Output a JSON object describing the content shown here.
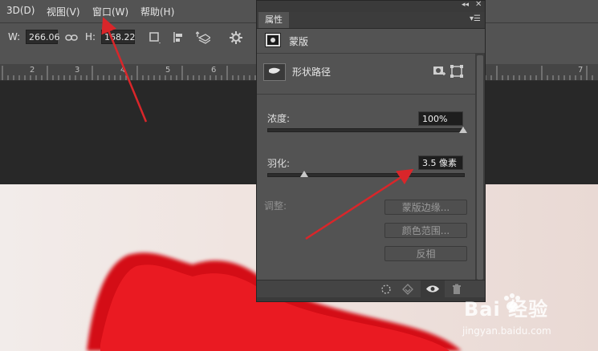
{
  "menu": {
    "items": [
      {
        "label": "3D(D)"
      },
      {
        "label": "视图(V)"
      },
      {
        "label": "窗口(W)"
      },
      {
        "label": "帮助(H)"
      }
    ]
  },
  "options": {
    "w_label": "W:",
    "w_value": "266.06",
    "h_label": "H:",
    "h_value": "168.22"
  },
  "ruler": {
    "numbers": [
      "2",
      "3",
      "4",
      "5",
      "6",
      "7"
    ]
  },
  "panel": {
    "tab_label": "属性",
    "mask_label": "蒙版",
    "shape_path_label": "形状路径",
    "density_label": "浓度:",
    "density_value": "100%",
    "density_fraction": 1.0,
    "feather_label": "羽化:",
    "feather_value": "3.5 像素",
    "feather_fraction": 0.19,
    "adjust_label": "调整:",
    "buttons": {
      "mask_edge": "蒙版边缘...",
      "color_range": "颜色范围...",
      "invert": "反相"
    }
  },
  "watermark": {
    "text": "Bai 经验",
    "url": "jingyan.baidu.com"
  },
  "colors": {
    "arrow": "#d9262a",
    "lip": "#e3121b",
    "skin": "#efe3df"
  }
}
